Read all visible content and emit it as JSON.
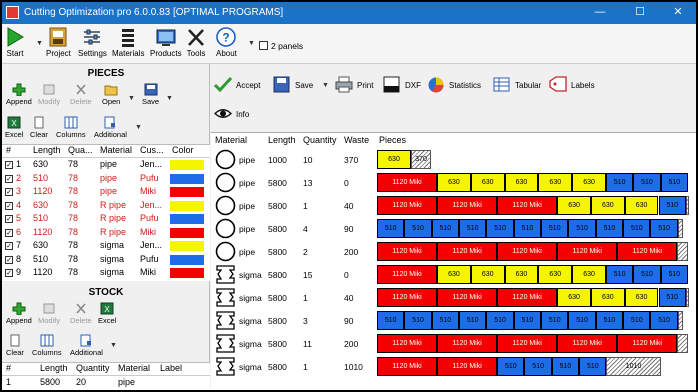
{
  "window": {
    "title": "Cutting Optimization pro 6.0.0.83 [OPTIMAL PROGRAMS]",
    "minimize": "—",
    "maximize": "☐",
    "close": "✕"
  },
  "toolbar": {
    "start": "Start",
    "project": "Project",
    "settings": "Settings",
    "materials": "Materials",
    "products": "Products",
    "tools": "Tools",
    "about": "About",
    "two_panels": "2 panels"
  },
  "pieces": {
    "title": "PIECES",
    "append": "Append",
    "modify": "Modify",
    "delete": "Delete",
    "open": "Open",
    "save": "Save",
    "excel": "Excel",
    "clear": "Clear",
    "columns": "Columns",
    "additional": "Additional",
    "headers": [
      "#",
      "Length",
      "Qua...",
      "Material",
      "Cus...",
      "Color"
    ],
    "rows": [
      {
        "n": "1",
        "length": "630",
        "qty": "78",
        "material": "pipe",
        "cust": "Jen...",
        "color": "#f5f500",
        "red": false
      },
      {
        "n": "2",
        "length": "510",
        "qty": "78",
        "material": "pipe",
        "cust": "Pufu",
        "color": "#1e6de8",
        "red": true
      },
      {
        "n": "3",
        "length": "1120",
        "qty": "78",
        "material": "pipe",
        "cust": "Miki",
        "color": "#f50000",
        "red": true
      },
      {
        "n": "4",
        "length": "630",
        "qty": "78",
        "material": "R pipe",
        "cust": "Jen...",
        "color": "#f5f500",
        "red": true
      },
      {
        "n": "5",
        "length": "510",
        "qty": "78",
        "material": "R pipe",
        "cust": "Pufu",
        "color": "#1e6de8",
        "red": true
      },
      {
        "n": "6",
        "length": "1120",
        "qty": "78",
        "material": "R pipe",
        "cust": "Miki",
        "color": "#f50000",
        "red": true
      },
      {
        "n": "7",
        "length": "630",
        "qty": "78",
        "material": "sigma",
        "cust": "Jen...",
        "color": "#f5f500",
        "red": false
      },
      {
        "n": "8",
        "length": "510",
        "qty": "78",
        "material": "sigma",
        "cust": "Pufu",
        "color": "#1e6de8",
        "red": false
      },
      {
        "n": "9",
        "length": "1120",
        "qty": "78",
        "material": "sigma",
        "cust": "Miki",
        "color": "#f50000",
        "red": false
      }
    ]
  },
  "stock": {
    "title": "STOCK",
    "append": "Append",
    "modify": "Modify",
    "delete": "Delete",
    "excel": "Excel",
    "clear": "Clear",
    "columns": "Columns",
    "additional": "Additional",
    "headers": [
      "#",
      "Length",
      "Quantity",
      "Material",
      "Label"
    ],
    "rows": [
      {
        "n": "1",
        "length": "5800",
        "qty": "20",
        "material": "pipe",
        "label": ""
      }
    ]
  },
  "actions": {
    "accept": "Accept",
    "save": "Save",
    "print": "Print",
    "dxf": "DXF",
    "statistics": "Statistics",
    "tabular": "Tabular",
    "labels": "Labels",
    "info": "Info"
  },
  "results": {
    "headers": [
      "Material",
      "Length",
      "Quantity",
      "Waste",
      "Pieces"
    ],
    "rows": [
      {
        "material": "pipe",
        "shape": "circle",
        "length": "1000",
        "qty": "10",
        "waste": "370",
        "pieces": [
          {
            "label": "630",
            "len": 630,
            "color": "#f5f500"
          },
          {
            "label": "370",
            "len": 370,
            "waste": true
          }
        ]
      },
      {
        "material": "pipe",
        "shape": "circle",
        "length": "5800",
        "qty": "13",
        "waste": "0",
        "pieces": [
          {
            "label": "1120 Miki",
            "len": 1120,
            "color": "#f50000"
          },
          {
            "label": "630",
            "len": 630,
            "color": "#f5f500"
          },
          {
            "label": "630",
            "len": 630,
            "color": "#f5f500"
          },
          {
            "label": "630",
            "len": 630,
            "color": "#f5f500"
          },
          {
            "label": "630",
            "len": 630,
            "color": "#f5f500"
          },
          {
            "label": "630",
            "len": 630,
            "color": "#f5f500"
          },
          {
            "label": "510",
            "len": 510,
            "color": "#1e6de8"
          },
          {
            "label": "510",
            "len": 510,
            "color": "#1e6de8"
          },
          {
            "label": "510",
            "len": 510,
            "color": "#1e6de8"
          }
        ]
      },
      {
        "material": "pipe",
        "shape": "circle",
        "length": "5800",
        "qty": "1",
        "waste": "40",
        "pieces": [
          {
            "label": "1120 Miki",
            "len": 1120,
            "color": "#f50000"
          },
          {
            "label": "1120 Miki",
            "len": 1120,
            "color": "#f50000"
          },
          {
            "label": "1120 Miki",
            "len": 1120,
            "color": "#f50000"
          },
          {
            "label": "630",
            "len": 630,
            "color": "#f5f500"
          },
          {
            "label": "630",
            "len": 630,
            "color": "#f5f500"
          },
          {
            "label": "630",
            "len": 630,
            "color": "#f5f500"
          },
          {
            "label": "510",
            "len": 510,
            "color": "#1e6de8"
          },
          {
            "label": "",
            "len": 40,
            "waste": true
          }
        ]
      },
      {
        "material": "pipe",
        "shape": "circle",
        "length": "5800",
        "qty": "4",
        "waste": "90",
        "pieces": [
          {
            "label": "510",
            "len": 510,
            "color": "#1e6de8"
          },
          {
            "label": "510",
            "len": 510,
            "color": "#1e6de8"
          },
          {
            "label": "510",
            "len": 510,
            "color": "#1e6de8"
          },
          {
            "label": "510",
            "len": 510,
            "color": "#1e6de8"
          },
          {
            "label": "510",
            "len": 510,
            "color": "#1e6de8"
          },
          {
            "label": "510",
            "len": 510,
            "color": "#1e6de8"
          },
          {
            "label": "510",
            "len": 510,
            "color": "#1e6de8"
          },
          {
            "label": "510",
            "len": 510,
            "color": "#1e6de8"
          },
          {
            "label": "510",
            "len": 510,
            "color": "#1e6de8"
          },
          {
            "label": "510",
            "len": 510,
            "color": "#1e6de8"
          },
          {
            "label": "510",
            "len": 510,
            "color": "#1e6de8"
          },
          {
            "label": "",
            "len": 90,
            "waste": true
          }
        ]
      },
      {
        "material": "pipe",
        "shape": "circle",
        "length": "5800",
        "qty": "2",
        "waste": "200",
        "pieces": [
          {
            "label": "1120 Miki",
            "len": 1120,
            "color": "#f50000"
          },
          {
            "label": "1120 Miki",
            "len": 1120,
            "color": "#f50000"
          },
          {
            "label": "1120 Miki",
            "len": 1120,
            "color": "#f50000"
          },
          {
            "label": "1120 Miki",
            "len": 1120,
            "color": "#f50000"
          },
          {
            "label": "1120 Miki",
            "len": 1120,
            "color": "#f50000"
          },
          {
            "label": "",
            "len": 200,
            "waste": true
          }
        ]
      },
      {
        "material": "sigma",
        "shape": "sigma",
        "length": "5800",
        "qty": "15",
        "waste": "0",
        "pieces": [
          {
            "label": "1120 Miki",
            "len": 1120,
            "color": "#f50000"
          },
          {
            "label": "630",
            "len": 630,
            "color": "#f5f500"
          },
          {
            "label": "630",
            "len": 630,
            "color": "#f5f500"
          },
          {
            "label": "630",
            "len": 630,
            "color": "#f5f500"
          },
          {
            "label": "630",
            "len": 630,
            "color": "#f5f500"
          },
          {
            "label": "630",
            "len": 630,
            "color": "#f5f500"
          },
          {
            "label": "510",
            "len": 510,
            "color": "#1e6de8"
          },
          {
            "label": "510",
            "len": 510,
            "color": "#1e6de8"
          },
          {
            "label": "510",
            "len": 510,
            "color": "#1e6de8"
          }
        ]
      },
      {
        "material": "sigma",
        "shape": "sigma",
        "length": "5800",
        "qty": "1",
        "waste": "40",
        "pieces": [
          {
            "label": "1120 Miki",
            "len": 1120,
            "color": "#f50000"
          },
          {
            "label": "1120 Miki",
            "len": 1120,
            "color": "#f50000"
          },
          {
            "label": "1120 Miki",
            "len": 1120,
            "color": "#f50000"
          },
          {
            "label": "630",
            "len": 630,
            "color": "#f5f500"
          },
          {
            "label": "630",
            "len": 630,
            "color": "#f5f500"
          },
          {
            "label": "630",
            "len": 630,
            "color": "#f5f500"
          },
          {
            "label": "510",
            "len": 510,
            "color": "#1e6de8"
          },
          {
            "label": "",
            "len": 40,
            "waste": true
          }
        ]
      },
      {
        "material": "sigma",
        "shape": "sigma",
        "length": "5800",
        "qty": "3",
        "waste": "90",
        "pieces": [
          {
            "label": "510",
            "len": 510,
            "color": "#1e6de8"
          },
          {
            "label": "510",
            "len": 510,
            "color": "#1e6de8"
          },
          {
            "label": "510",
            "len": 510,
            "color": "#1e6de8"
          },
          {
            "label": "510",
            "len": 510,
            "color": "#1e6de8"
          },
          {
            "label": "510",
            "len": 510,
            "color": "#1e6de8"
          },
          {
            "label": "510",
            "len": 510,
            "color": "#1e6de8"
          },
          {
            "label": "510",
            "len": 510,
            "color": "#1e6de8"
          },
          {
            "label": "510",
            "len": 510,
            "color": "#1e6de8"
          },
          {
            "label": "510",
            "len": 510,
            "color": "#1e6de8"
          },
          {
            "label": "510",
            "len": 510,
            "color": "#1e6de8"
          },
          {
            "label": "510",
            "len": 510,
            "color": "#1e6de8"
          },
          {
            "label": "",
            "len": 90,
            "waste": true
          }
        ]
      },
      {
        "material": "sigma",
        "shape": "sigma",
        "length": "5800",
        "qty": "11",
        "waste": "200",
        "pieces": [
          {
            "label": "1120 Miki",
            "len": 1120,
            "color": "#f50000"
          },
          {
            "label": "1120 Miki",
            "len": 1120,
            "color": "#f50000"
          },
          {
            "label": "1120 Miki",
            "len": 1120,
            "color": "#f50000"
          },
          {
            "label": "1120 Miki",
            "len": 1120,
            "color": "#f50000"
          },
          {
            "label": "1120 Miki",
            "len": 1120,
            "color": "#f50000"
          },
          {
            "label": "",
            "len": 200,
            "waste": true
          }
        ]
      },
      {
        "material": "sigma",
        "shape": "sigma",
        "length": "5800",
        "qty": "1",
        "waste": "1010",
        "pieces": [
          {
            "label": "1120 Miki",
            "len": 1120,
            "color": "#f50000"
          },
          {
            "label": "1120 Miki",
            "len": 1120,
            "color": "#f50000"
          },
          {
            "label": "510",
            "len": 510,
            "color": "#1e6de8"
          },
          {
            "label": "510",
            "len": 510,
            "color": "#1e6de8"
          },
          {
            "label": "510",
            "len": 510,
            "color": "#1e6de8"
          },
          {
            "label": "510",
            "len": 510,
            "color": "#1e6de8"
          },
          {
            "label": "1010",
            "len": 1010,
            "waste": true
          }
        ]
      }
    ]
  }
}
